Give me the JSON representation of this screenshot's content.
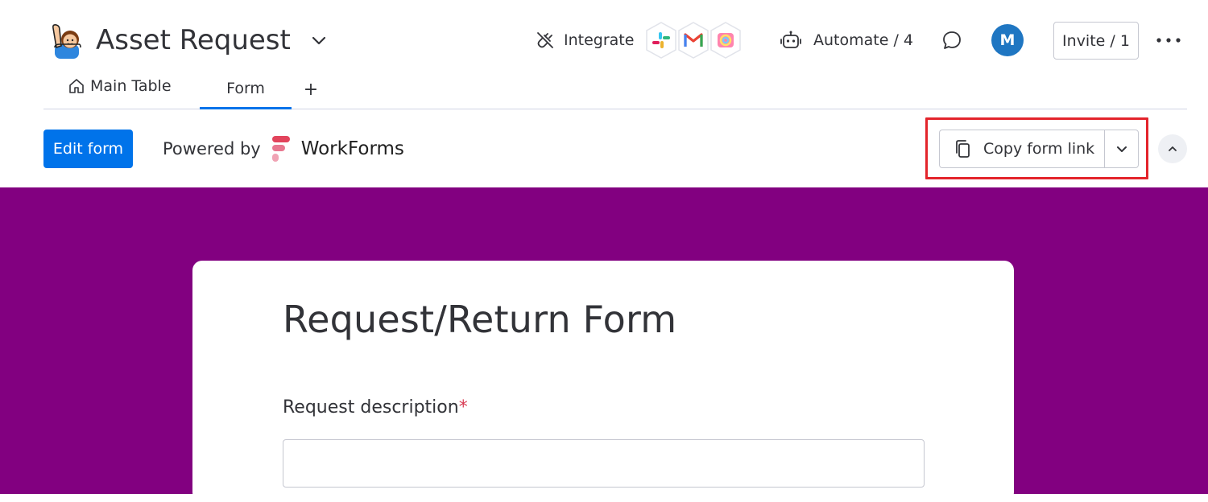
{
  "header": {
    "board_title": "Asset Request",
    "integrate_label": "Integrate",
    "integrate_logos": [
      "slack-icon",
      "gmail-icon",
      "creative-cloud-icon"
    ],
    "automate_label": "Automate / 4",
    "avatar_initial": "M",
    "invite_label": "Invite / 1"
  },
  "tabs": [
    {
      "label": "Main Table",
      "icon": "home-icon"
    },
    {
      "label": "Form",
      "active": true
    },
    {
      "label": "+"
    }
  ],
  "toolbar": {
    "edit_form_label": "Edit form",
    "powered_by_label": "Powered by",
    "brand_name": "WorkForms",
    "copy_link_label": "Copy form link"
  },
  "form": {
    "title": "Request/Return Form",
    "field_label": "Request description",
    "required_marker": "*",
    "field_value": ""
  },
  "colors": {
    "primary": "#0073ea",
    "purple_background": "#820080",
    "highlight": "#e3242b",
    "avatar": "#1f76c2",
    "required": "#d83a52"
  }
}
